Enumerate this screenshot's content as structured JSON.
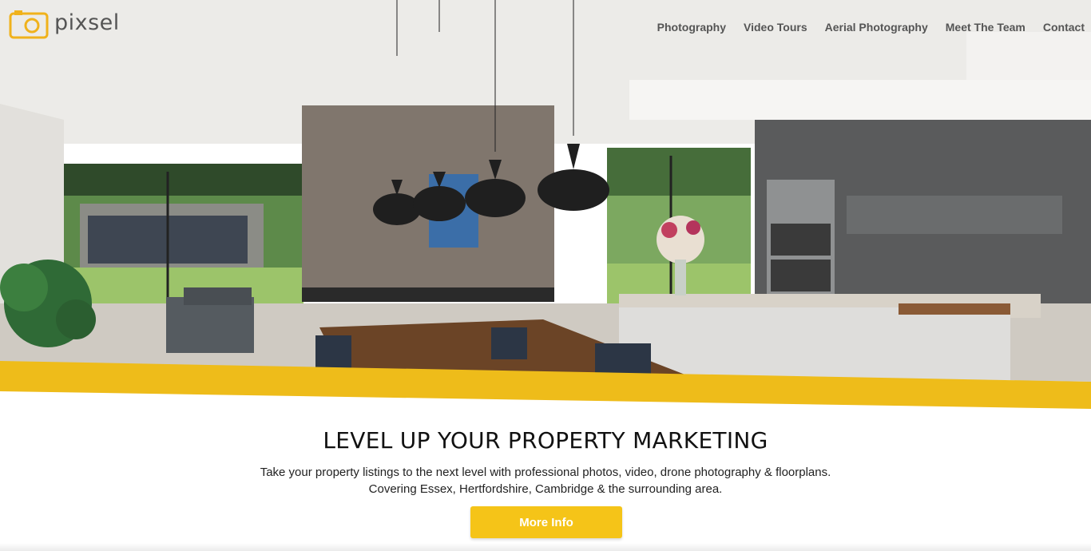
{
  "logo": {
    "text": "pixsel",
    "icon": "camera-icon",
    "accent": "#f0b21c"
  },
  "nav": {
    "items": [
      {
        "label": "Photography"
      },
      {
        "label": "Video Tours"
      },
      {
        "label": "Aerial Photography"
      },
      {
        "label": "Meet The Team"
      },
      {
        "label": "Contact"
      }
    ]
  },
  "hero": {
    "image": "modern open-plan kitchen and living room with pendant lights",
    "band_color": "#eebc1a"
  },
  "main": {
    "headline": "LEVEL UP YOUR PROPERTY MARKETING",
    "line1": "Take your property listings to the next level with professional photos, video, drone photography & floorplans.",
    "line2": "Covering Essex, Hertfordshire, Cambridge & the surrounding area.",
    "cta_label": "More Info",
    "cta_color": "#f5c418"
  }
}
